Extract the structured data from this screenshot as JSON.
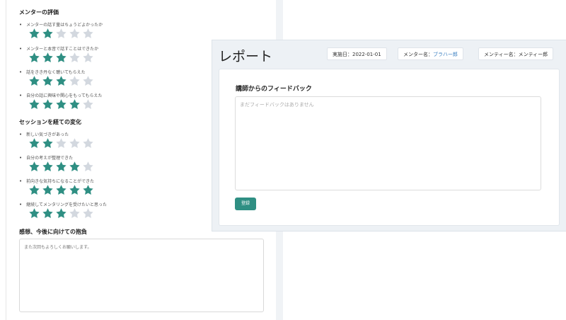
{
  "evaluation": {
    "mentor_section_title": "メンターの評価",
    "mentor_questions": [
      {
        "label": "メンターの話す量はちょうどよかったか",
        "rating": 2
      },
      {
        "label": "メンターと本音で話すことはできたか",
        "rating": 3
      },
      {
        "label": "話をきき丹なく聴いてもらえた",
        "rating": 3
      },
      {
        "label": "自分の話に興味や関心をもってもらえた",
        "rating": 4
      }
    ],
    "change_section_title": "セッションを経ての変化",
    "change_questions": [
      {
        "label": "新しい気づきがあった",
        "rating": 2
      },
      {
        "label": "自分の考えが整理できた",
        "rating": 4
      },
      {
        "label": "前向きな気持ちになることができた",
        "rating": 5
      },
      {
        "label": "継続してメンタリングを受けたいと思った",
        "rating": 3
      }
    ],
    "max_rating": 5,
    "comment_title": "感想、今後に向けての抱負",
    "comment_value": "また次回もよろしくお願いします。"
  },
  "report": {
    "title": "レポート",
    "date_label": "実施日：2022-01-01",
    "mentor_prefix": "メンター名：",
    "mentor_name": "ブラハー郎",
    "mentee_label": "メンティー名：メンティー郎",
    "feedback_title": "講師からのフィードバック",
    "feedback_placeholder": "まだフィードバックはありません",
    "submit_label": "登録"
  },
  "colors": {
    "star_filled": "#2f8f83",
    "star_empty": "#d3d8df",
    "link": "#3a7fc1",
    "button": "#2f8f83"
  }
}
